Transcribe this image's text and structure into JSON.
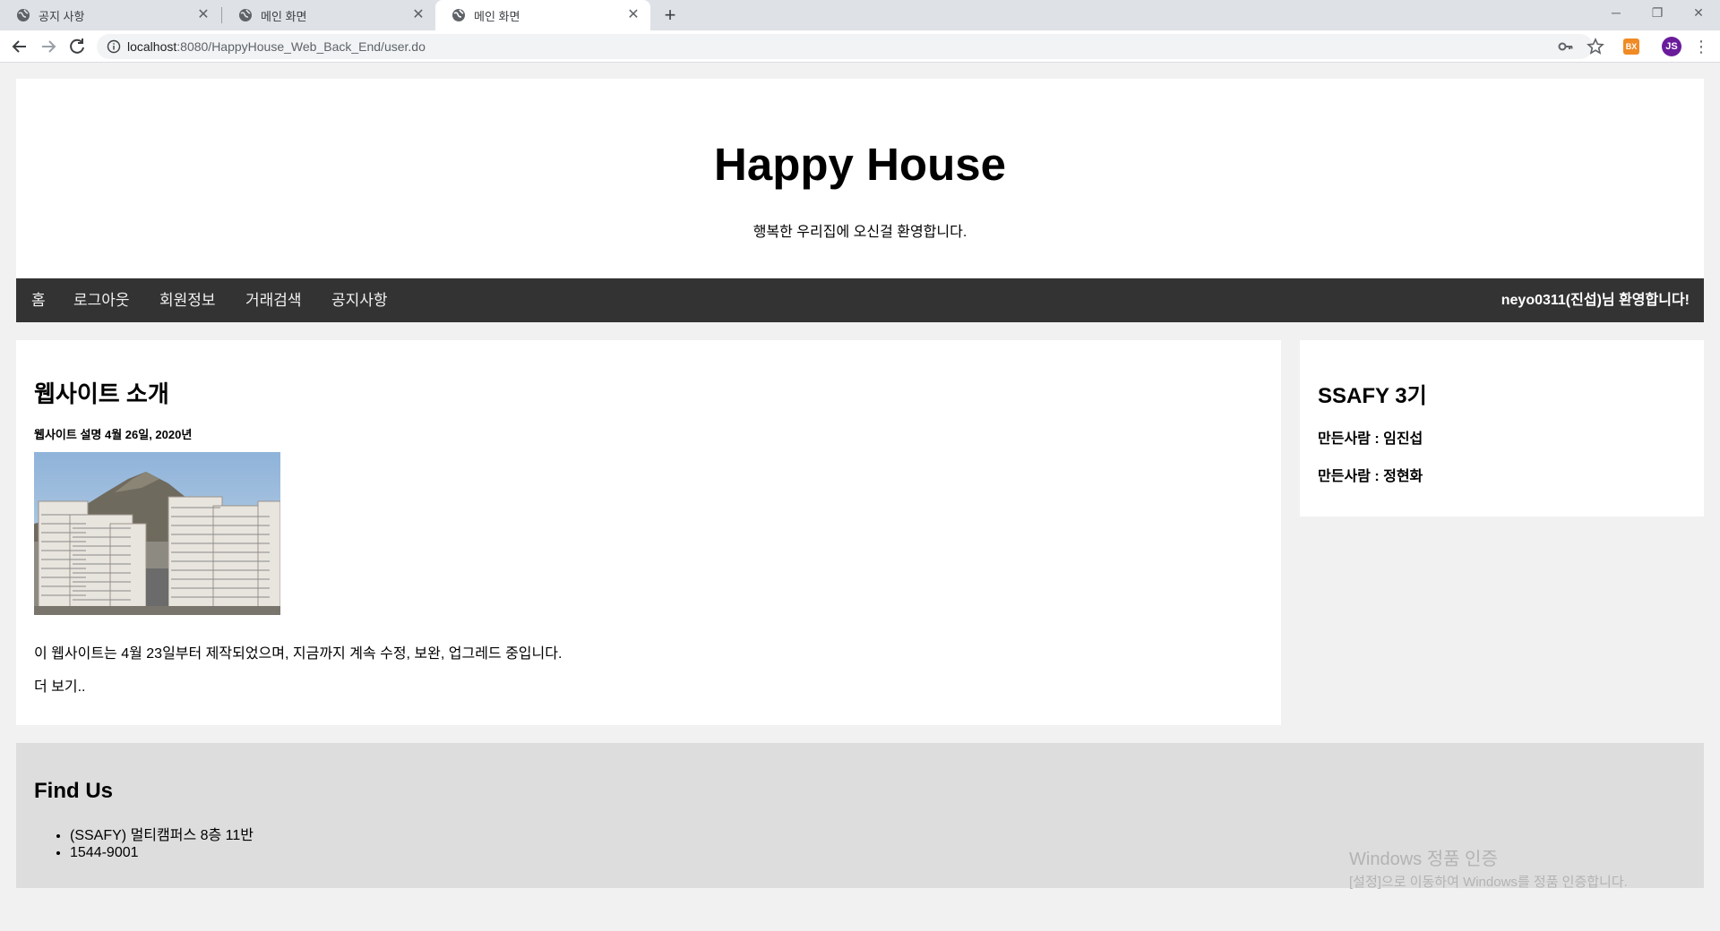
{
  "browser": {
    "tabs": [
      {
        "title": "공지 사항",
        "active": false
      },
      {
        "title": "메인 화면",
        "active": false
      },
      {
        "title": "메인 화면",
        "active": true
      }
    ],
    "url_host": "localhost",
    "url_rest": ":8080/HappyHouse_Web_Back_End/user.do",
    "ext_label": "BX",
    "avatar_initials": "JS"
  },
  "header": {
    "title": "Happy House",
    "subtitle": "행복한 우리집에 오신걸 환영합니다."
  },
  "nav": {
    "items": [
      "홈",
      "로그아웃",
      "회원정보",
      "거래검색",
      "공지사항"
    ],
    "welcome": "neyo0311(진섭)님 환영합니다!"
  },
  "main": {
    "heading": "웹사이트 소개",
    "subheading": "웹사이트 설명 4월 26일, 2020년",
    "description": "이 웹사이트는 4월 23일부터 제작되었으며, 지금까지 계속 수정, 보완, 업그레드 중입니다.",
    "more": "더 보기.."
  },
  "side": {
    "heading": "SSAFY 3기",
    "makers": [
      "만든사람 : 임진섭",
      "만든사람 : 정현화"
    ]
  },
  "footer": {
    "heading": "Find Us",
    "items": [
      "(SSAFY) 멀티캠퍼스 8층 11반",
      "1544-9001"
    ]
  },
  "watermark": {
    "title": "Windows 정품 인증",
    "subtitle": "[설정]으로 이동하여 Windows를 정품 인증합니다."
  },
  "colors": {
    "nav_bg": "#333333",
    "footer_bg": "#dddddd",
    "page_bg": "#f1f1f1"
  }
}
